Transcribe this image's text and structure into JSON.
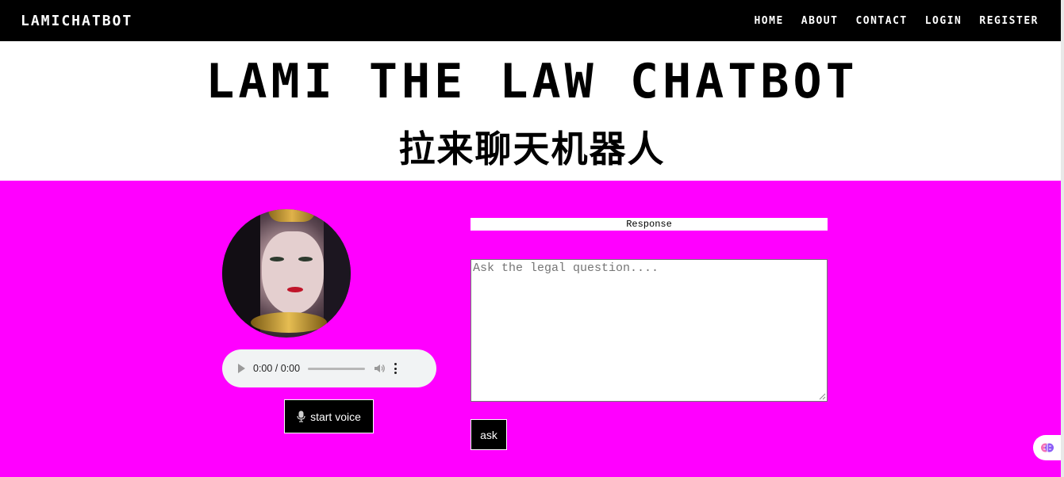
{
  "navbar": {
    "brand": "LAMICHATBOT",
    "links": [
      "HOME",
      "ABOUT",
      "CONTACT",
      "LOGIN",
      "REGISTER"
    ]
  },
  "header": {
    "title": "LAMI THE LAW CHATBOT",
    "subtitle": "拉来聊天机器人"
  },
  "voice_panel": {
    "avatar_icon": "avatar-portrait",
    "audio": {
      "time": "0:00 / 0:00",
      "progress": 0
    },
    "start_voice_label": "start voice",
    "mic_icon": "microphone-icon"
  },
  "chat": {
    "response_label": "Response",
    "question_value": "",
    "question_placeholder": "Ask the legal question....",
    "ask_label": "ask"
  },
  "colors": {
    "navbar_bg": "#000000",
    "main_bg": "#ff00ff",
    "button_bg": "#000000"
  }
}
